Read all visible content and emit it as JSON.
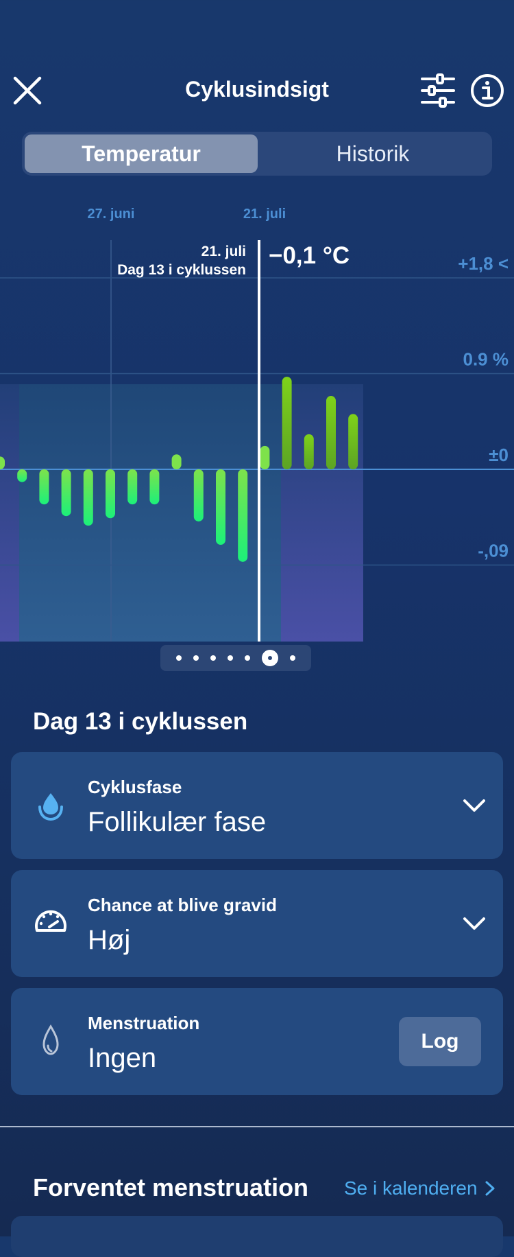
{
  "header": {
    "title": "Cyklusindsigt",
    "close_icon": "close-icon",
    "filter_icon": "sliders-icon",
    "info_icon": "info-icon"
  },
  "tabs": [
    {
      "label": "Temperatur",
      "selected": true
    },
    {
      "label": "Historik",
      "selected": false
    }
  ],
  "chart_data": {
    "type": "bar",
    "date_labels": [
      "27. juni",
      "21. juli"
    ],
    "tooltip": {
      "date": "21. juli",
      "cycle_day": "Dag 13 i cyklussen",
      "value": "−0,1 °C"
    },
    "y_tick_labels": [
      "+1,8 <",
      "0.9 %",
      "±0",
      "-,09"
    ],
    "y_tick_values": [
      1.8,
      0.9,
      0,
      -0.9
    ],
    "ylim": [
      -1.6,
      2.0
    ],
    "values": [
      0.12,
      -0.12,
      -0.33,
      -0.44,
      -0.53,
      -0.46,
      -0.33,
      -0.33,
      0.14,
      -0.49,
      -0.71,
      -0.87,
      0.22,
      0.87,
      0.33,
      0.69,
      0.52
    ],
    "colors": {
      "negative": "#2ee86a",
      "positive": "#6fbd22",
      "selected": "#ffffff",
      "axis": "#4c8fd4"
    }
  },
  "pager": {
    "count": 7,
    "active_index": 5
  },
  "cycle_day_heading": "Dag 13 i cyklussen",
  "cards": [
    {
      "label": "Cyklusfase",
      "value": "Follikulær fase",
      "icon": "drop-icon"
    },
    {
      "label": "Chance at blive gravid",
      "value": "Høj",
      "icon": "speedometer-icon"
    },
    {
      "label": "Menstruation",
      "value": "Ingen",
      "icon": "drop-outline-icon",
      "button": "Log"
    }
  ],
  "expected": {
    "title": "Forventet menstruation",
    "link": "Se i kalenderen"
  }
}
